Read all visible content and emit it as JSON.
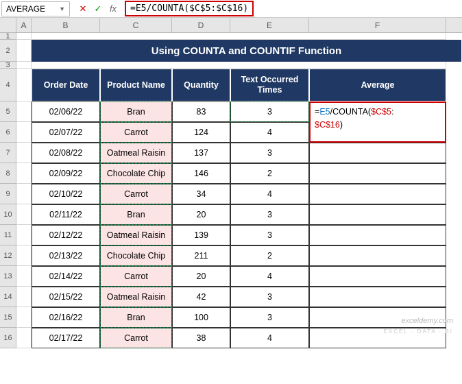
{
  "namebox": "AVERAGE",
  "formula": "=E5/COUNTA($C$5:$C$16)",
  "f5_parts": {
    "eq": "=",
    "r1": "E5",
    "mid": "/COUNTA(",
    "r2a": "$C$5",
    "colon": ":",
    "r2b": "$C$16",
    "end": ")"
  },
  "cols": [
    "A",
    "B",
    "C",
    "D",
    "E",
    "F"
  ],
  "rows": [
    "1",
    "2",
    "3",
    "4",
    "5",
    "6",
    "7",
    "8",
    "9",
    "10",
    "11",
    "12",
    "13",
    "14",
    "15",
    "16"
  ],
  "title": "Using COUNTA and COUNTIF Function",
  "headers": {
    "b": "Order Date",
    "c": "Product Name",
    "d": "Quantity",
    "e": "Text Occurred Times",
    "f": "Average"
  },
  "data": [
    {
      "b": "02/06/22",
      "c": "Bran",
      "d": "83",
      "e": "3"
    },
    {
      "b": "02/07/22",
      "c": "Carrot",
      "d": "124",
      "e": "4"
    },
    {
      "b": "02/08/22",
      "c": "Oatmeal Raisin",
      "d": "137",
      "e": "3"
    },
    {
      "b": "02/09/22",
      "c": "Chocolate Chip",
      "d": "146",
      "e": "2"
    },
    {
      "b": "02/10/22",
      "c": "Carrot",
      "d": "34",
      "e": "4"
    },
    {
      "b": "02/11/22",
      "c": "Bran",
      "d": "20",
      "e": "3"
    },
    {
      "b": "02/12/22",
      "c": "Oatmeal Raisin",
      "d": "139",
      "e": "3"
    },
    {
      "b": "02/13/22",
      "c": "Chocolate Chip",
      "d": "211",
      "e": "2"
    },
    {
      "b": "02/14/22",
      "c": "Carrot",
      "d": "20",
      "e": "4"
    },
    {
      "b": "02/15/22",
      "c": "Oatmeal Raisin",
      "d": "42",
      "e": "3"
    },
    {
      "b": "02/16/22",
      "c": "Bran",
      "d": "100",
      "e": "3"
    },
    {
      "b": "02/17/22",
      "c": "Carrot",
      "d": "38",
      "e": "4"
    }
  ],
  "watermark": "exceldemy.com",
  "watermark2": "EXCEL · DATA · BI",
  "chart_data": {
    "type": "table",
    "title": "Using COUNTA and COUNTIF Function",
    "columns": [
      "Order Date",
      "Product Name",
      "Quantity",
      "Text Occurred Times",
      "Average"
    ],
    "rows": [
      [
        "02/06/22",
        "Bran",
        83,
        3,
        null
      ],
      [
        "02/07/22",
        "Carrot",
        124,
        4,
        null
      ],
      [
        "02/08/22",
        "Oatmeal Raisin",
        137,
        3,
        null
      ],
      [
        "02/09/22",
        "Chocolate Chip",
        146,
        2,
        null
      ],
      [
        "02/10/22",
        "Carrot",
        34,
        4,
        null
      ],
      [
        "02/11/22",
        "Bran",
        20,
        3,
        null
      ],
      [
        "02/12/22",
        "Oatmeal Raisin",
        139,
        3,
        null
      ],
      [
        "02/13/22",
        "Chocolate Chip",
        211,
        2,
        null
      ],
      [
        "02/14/22",
        "Carrot",
        20,
        4,
        null
      ],
      [
        "02/15/22",
        "Oatmeal Raisin",
        42,
        3,
        null
      ],
      [
        "02/16/22",
        "Bran",
        100,
        3,
        null
      ],
      [
        "02/17/22",
        "Carrot",
        38,
        4,
        null
      ]
    ],
    "formula_cell": {
      "address": "F5",
      "formula": "=E5/COUNTA($C$5:$C$16)"
    }
  }
}
